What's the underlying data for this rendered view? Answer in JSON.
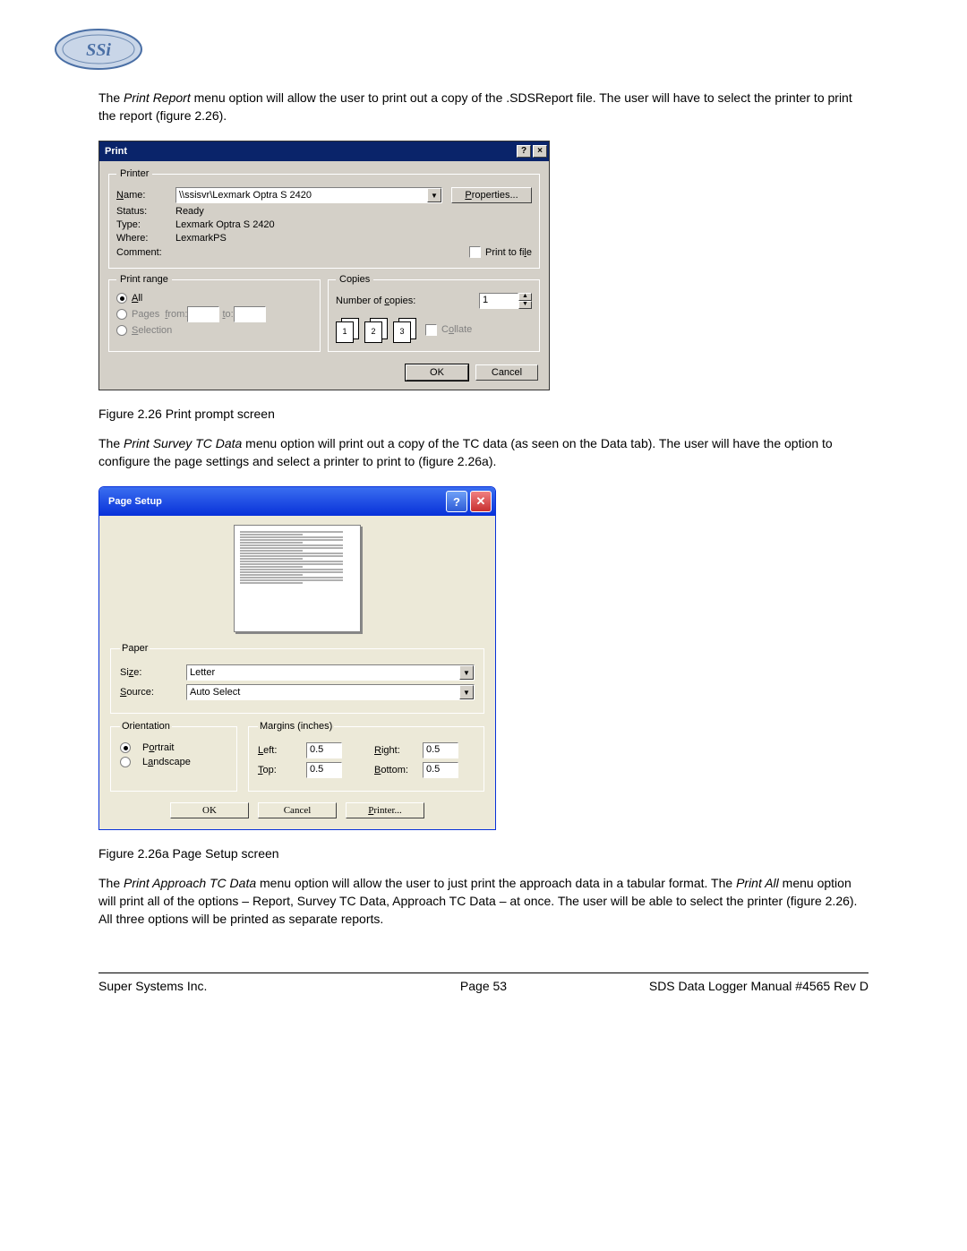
{
  "para1_pre": "The ",
  "para1_em": "Print Report",
  "para1_post": " menu option will allow the user to print out a copy of the .SDSReport file. The user will have to select the printer to print the report (figure 2.26).",
  "printDialog": {
    "title": "Print",
    "printerLegend": "Printer",
    "nameLabel": "Name:",
    "nameValue": "\\\\ssisvr\\Lexmark Optra S 2420",
    "propertiesBtn": "Properties...",
    "statusLabel": "Status:",
    "statusValue": "Ready",
    "typeLabel": "Type:",
    "typeValue": "Lexmark Optra S 2420",
    "whereLabel": "Where:",
    "whereValue": "LexmarkPS",
    "commentLabel": "Comment:",
    "printToFile": "Print to file",
    "rangeLegend": "Print range",
    "rangeAll": "All",
    "rangePages": "Pages",
    "rangeFrom": "from:",
    "rangeTo": "to:",
    "rangeSelection": "Selection",
    "copiesLegend": "Copies",
    "numCopiesLabel": "Number of copies:",
    "numCopiesValue": "1",
    "collate": "Collate",
    "ok": "OK",
    "cancel": "Cancel"
  },
  "caption1": "Figure 2.26 Print prompt screen",
  "para2_pre": "The ",
  "para2_em": "Print Survey TC Data",
  "para2_post": " menu option will print out a copy of the TC data (as seen on the Data tab). The user will have the option to configure the page settings and select a printer to print to (figure 2.26a).",
  "pageSetup": {
    "title": "Page Setup",
    "paperLegend": "Paper",
    "sizeLabel": "Size:",
    "sizeValue": "Letter",
    "sourceLabel": "Source:",
    "sourceValue": "Auto Select",
    "orientLegend": "Orientation",
    "portrait": "Portrait",
    "landscape": "Landscape",
    "marginsLegend": "Margins (inches)",
    "leftLabel": "Left:",
    "leftVal": "0.5",
    "rightLabel": "Right:",
    "rightVal": "0.5",
    "topLabel": "Top:",
    "topVal": "0.5",
    "bottomLabel": "Bottom:",
    "bottomVal": "0.5",
    "ok": "OK",
    "cancel": "Cancel",
    "printer": "Printer..."
  },
  "caption2": "Figure 2.26a Page Setup screen",
  "para3_pre": "The ",
  "para3_em1": "Print Approach TC Data ",
  "para3_mid1": " menu option will allow the user to just print the approach data in a tabular format.  The ",
  "para3_em2": "Print All",
  "para3_mid2": " menu option will print all of the options – Report, Survey TC Data, Approach TC Data – at once.  The user will be able to select the printer (figure 2.26).  All three options will be printed as separate reports.",
  "footer": {
    "left": "Super Systems Inc.",
    "center": "Page 53",
    "right": "SDS Data Logger Manual #4565 Rev D"
  }
}
